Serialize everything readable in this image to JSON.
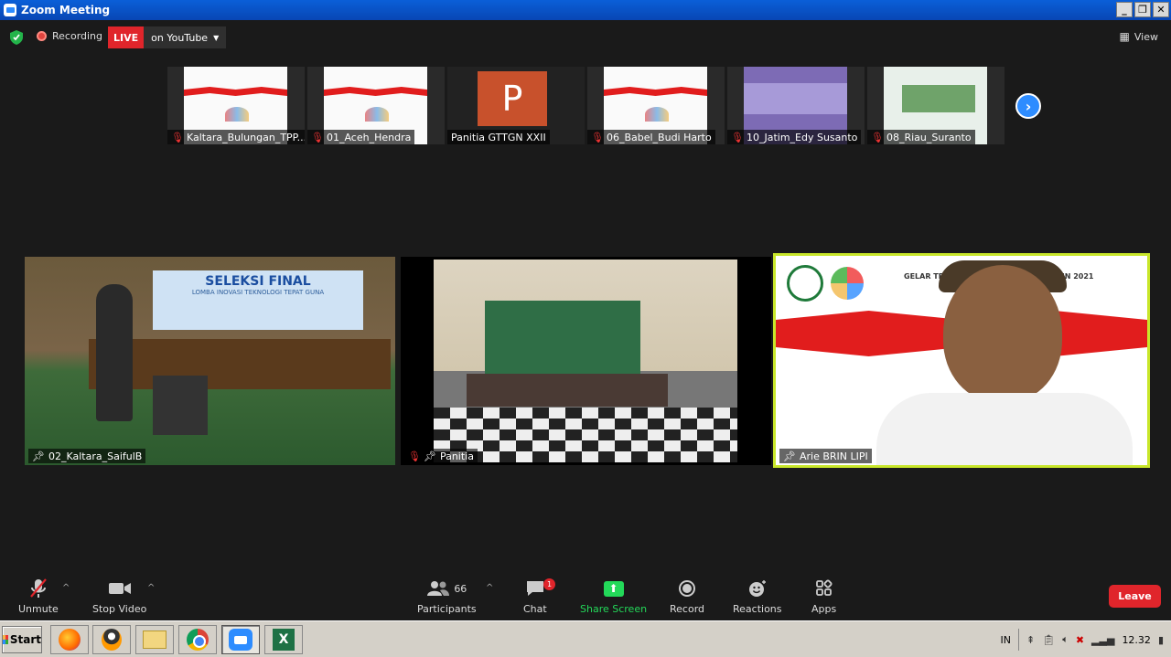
{
  "window": {
    "title": "Zoom Meeting"
  },
  "topbar": {
    "recording_label": "Recording",
    "live_label": "LIVE",
    "stream_target": "on YouTube",
    "view_label": "View"
  },
  "thumbnails": [
    {
      "name": "Kaltara_Bulungan_TPP...",
      "muted": true,
      "kind": "slide"
    },
    {
      "name": "01_Aceh_Hendra",
      "muted": true,
      "kind": "slide"
    },
    {
      "name": "Panitia GTTGN XXII",
      "muted": false,
      "kind": "ppt",
      "tile_letter": "P"
    },
    {
      "name": "06_Babel_Budi Harto",
      "muted": true,
      "kind": "slide"
    },
    {
      "name": "10_Jatim_Edy Susanto",
      "muted": true,
      "kind": "purple"
    },
    {
      "name": "08_Riau_Suranto",
      "muted": true,
      "kind": "green"
    }
  ],
  "main_tiles": [
    {
      "name": "02_Kaltara_SaifulB",
      "banner_title": "SELEKSI FINAL",
      "banner_sub": "LOMBA INOVASI TEKNOLOGI TEPAT GUNA"
    },
    {
      "name": "Panitia"
    },
    {
      "name": "Arie BRIN LIPI",
      "header_text": "GELAR TEKNOLOGI TE... NAL XXII TAHUN 2021",
      "active_speaker": true
    }
  ],
  "toolbar": {
    "unmute": "Unmute",
    "stop_video": "Stop Video",
    "participants": "Participants",
    "participants_count": "66",
    "chat": "Chat",
    "chat_badge": "1",
    "share_screen": "Share Screen",
    "record": "Record",
    "reactions": "Reactions",
    "apps": "Apps",
    "leave": "Leave"
  },
  "taskbar": {
    "start_label": "Start",
    "lang": "IN",
    "clock": "12.32",
    "apps": [
      "firefox",
      "gimp",
      "file-manager",
      "chrome",
      "zoom",
      "excel"
    ],
    "active_app": "zoom"
  }
}
